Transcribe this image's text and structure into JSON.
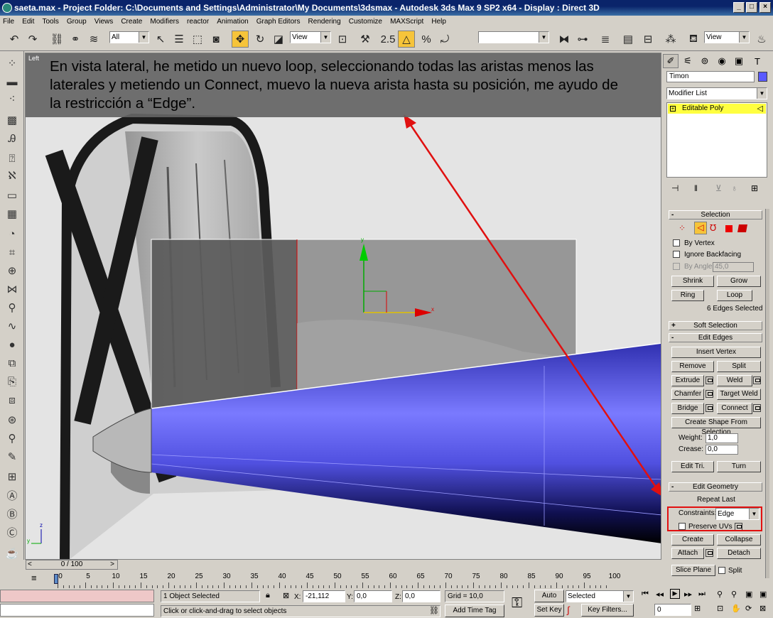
{
  "window": {
    "title": "saeta.max    - Project Folder: C:\\Documents and Settings\\Administrator\\My Documents\\3dsmax     - Autodesk 3ds Max 9 SP2 x64     - Display : Direct 3D",
    "minimize": "_",
    "maximize": "□",
    "close": "×"
  },
  "menu": [
    "File",
    "Edit",
    "Tools",
    "Group",
    "Views",
    "Create",
    "Modifiers",
    "reactor",
    "Animation",
    "Graph Editors",
    "Rendering",
    "Customize",
    "MAXScript",
    "Help"
  ],
  "toolbar": {
    "selection_filter": "All",
    "reference_coord": "View",
    "named_selection": "",
    "view_combo": "View",
    "snap_value": "2.5"
  },
  "viewport": {
    "label": "Left",
    "annotation": "En vista lateral, he metido un nuevo loop, seleccionando todas las aristas menos las laterales y metiendo un Connect, muevo la nueva arista hasta su posición, me ayudo de la restricción a “Edge”.",
    "gizmo_y": "y",
    "gizmo_x": "x",
    "axis_z": "z",
    "axis_y": "y"
  },
  "command_panel": {
    "object_name": "Timon",
    "object_color": "#5a5aff",
    "modifier_list": "Modifier List",
    "stack_item": "Editable Poly",
    "selection": {
      "header": "Selection",
      "by_vertex": "By Vertex",
      "ignore_backfacing": "Ignore Backfacing",
      "by_angle": "By Angle:",
      "by_angle_value": "45,0",
      "shrink": "Shrink",
      "grow": "Grow",
      "ring": "Ring",
      "loop": "Loop",
      "status": "6 Edges Selected"
    },
    "soft_selection": "Soft Selection",
    "edit_edges": {
      "header": "Edit Edges",
      "insert_vertex": "Insert Vertex",
      "remove": "Remove",
      "split": "Split",
      "extrude": "Extrude",
      "weld": "Weld",
      "chamfer": "Chamfer",
      "target_weld": "Target Weld",
      "bridge": "Bridge",
      "connect": "Connect",
      "create_shape": "Create Shape From Selection",
      "weight_label": "Weight:",
      "weight_value": "1,0",
      "crease_label": "Crease:",
      "crease_value": "0,0",
      "edit_tri": "Edit Tri.",
      "turn": "Turn"
    },
    "edit_geometry": {
      "header": "Edit Geometry",
      "repeat_last": "Repeat Last",
      "constraints_label": "Constraints:",
      "constraints_value": "Edge",
      "preserve_uvs": "Preserve UVs",
      "create": "Create",
      "collapse": "Collapse",
      "attach": "Attach",
      "detach": "Detach",
      "slice_plane": "Slice Plane",
      "split": "Split"
    }
  },
  "timeline": {
    "slider": "0 / 100",
    "prev": "<",
    "next": ">",
    "ticks": [
      "0",
      "5",
      "10",
      "15",
      "20",
      "25",
      "30",
      "35",
      "40",
      "45",
      "50",
      "55",
      "60",
      "65",
      "70",
      "75",
      "80",
      "85",
      "90",
      "95",
      "100"
    ]
  },
  "status": {
    "selected": "1 Object Selected",
    "prompt": "Click or click-and-drag to select objects",
    "x_label": "X:",
    "x_value": "-21,112",
    "y_label": "Y:",
    "y_value": "0,0",
    "z_label": "Z:",
    "z_value": "0,0",
    "grid": "Grid = 10,0",
    "add_time_tag": "Add Time Tag",
    "auto_key": "Auto Key",
    "set_key": "Set Key",
    "selected_combo": "Selected",
    "key_filters": "Key Filters...",
    "frame": "0"
  }
}
